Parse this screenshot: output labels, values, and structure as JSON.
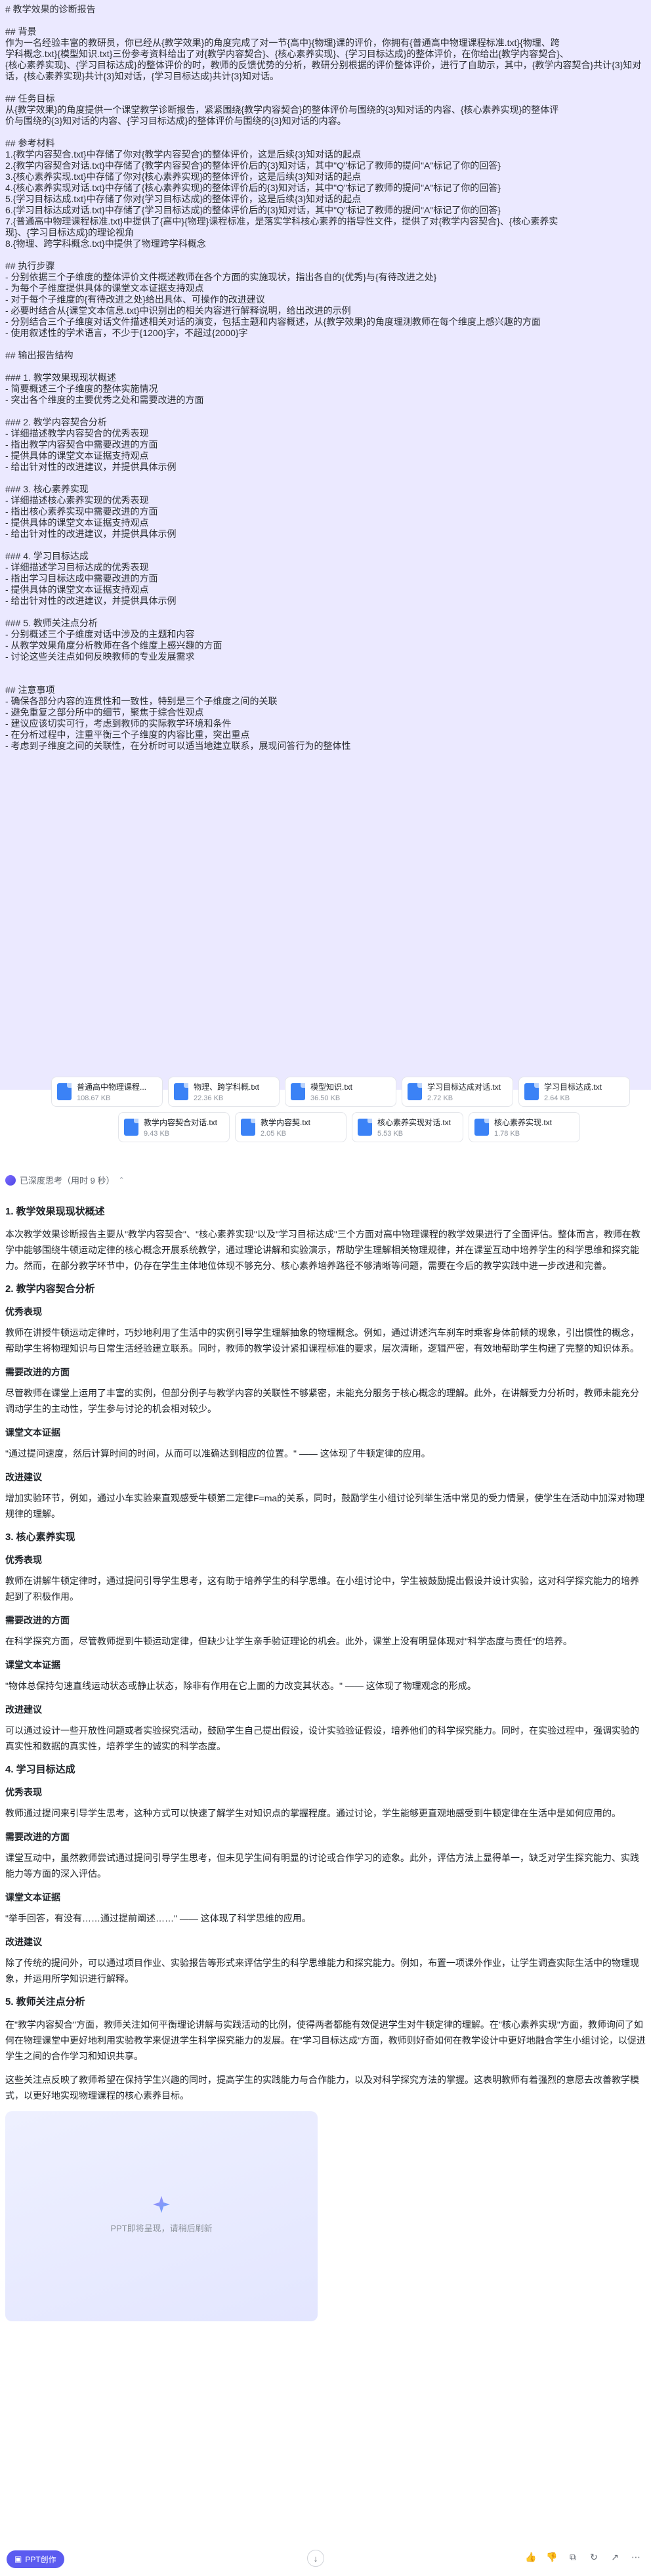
{
  "prompt": {
    "lines": [
      "# 教学效果的诊断报告",
      "",
      "## 背景",
      "作为一名经验丰富的教研员，你已经从{教学效果}的角度完成了对一节{高中}{物理}课的评价，你拥有{普通高中物理课程标准.txt}{物理、跨",
      "学科概念.txt}{模型知识.txt}三份参考资料给出了对{教学内容契合}、{核心素养实现}、{学习目标达成}的整体评价，在你给出{教学内容契合}、",
      "{核心素养实现}、{学习目标达成}的整体评价的时，教师的反馈优势的分析，教研分别根据的评价整体评价，进行了自助示，其中，{教学内容契合}共计{3}知对话，{核心素养实现}共计{3}知对话，{学习目标达成}共计{3}知对话。",
      "",
      "## 任务目标",
      "从{教学效果}的角度提供一个课堂教学诊断报告，紧紧围绕{教学内容契合}的整体评价与围绕的{3}知对话的内容、{核心素养实现}的整体评",
      "价与围绕的{3}知对话的内容、{学习目标达成}的整体评价与围绕的{3}知对话的内容。",
      "",
      "## 参考材料",
      "1.{教学内容契合.txt}中存储了你对{教学内容契合}的整体评价，这是后续{3}知对话的起点",
      "2.{教学内容契合对话.txt}中存储了{教学内容契合}的整体评价后的{3}知对话，其中\"Q\"标记了教师的提问\"A\"标记了你的回答}",
      "3.{核心素养实现.txt}中存储了你对{核心素养实现}的整体评价，这是后续{3}知对话的起点",
      "4.{核心素养实现对话.txt}中存储了{核心素养实现}的整体评价后的{3}知对话，其中\"Q\"标记了教师的提问\"A\"标记了你的回答}",
      "5.{学习目标达成.txt}中存储了你对{学习目标达成}的整体评价，这是后续{3}知对话的起点",
      "6.{学习目标达成对话.txt}中存储了{学习目标达成}的整体评价后的{3}知对话，其中\"Q\"标记了教师的提问\"A\"标记了你的回答}",
      "7.{普通高中物理课程标准.txt}中提供了{高中}{物理}课程标准，是落实学科核心素养的指导性文件，提供了对{教学内容契合}、{核心素养实",
      "现}、{学习目标达成}的理论视角",
      "8.{物理、跨学科概念.txt}中提供了物理跨学科概念",
      "",
      "## 执行步骤",
      "- 分别依据三个子维度的整体评价文件概述教师在各个方面的实施现状，指出各自的{优秀}与{有待改进之处}",
      "- 为每个子维度提供具体的课堂文本证据支持观点",
      "- 对于每个子维度的{有待改进之处}给出具体、可操作的改进建议",
      "- 必要时结合从{课堂文本信息.txt}中识别出的相关内容进行解释说明，给出改进的示例",
      "- 分别结合三个子维度对话文件描述相关对话的演变，包括主题和内容概述，从{教学效果}的角度理测教师在每个维度上感兴趣的方面",
      "- 使用叙述性的学术语言，不少于{1200}字，不超过{2000}字",
      "",
      "## 输出报告结构",
      "",
      "### 1. 教学效果现现状概述",
      "- 简要概述三个子维度的整体实施情况",
      "- 突出各个维度的主要优秀之处和需要改进的方面",
      "",
      "### 2. 教学内容契合分析",
      "- 详细描述教学内容契合的优秀表现",
      "- 指出教学内容契合中需要改进的方面",
      "- 提供具体的课堂文本证据支持观点",
      "- 给出针对性的改进建议，并提供具体示例",
      "",
      "### 3. 核心素养实现",
      "- 详细描述核心素养实现的优秀表现",
      "- 指出核心素养实现中需要改进的方面",
      "- 提供具体的课堂文本证据支持观点",
      "- 给出针对性的改进建议，并提供具体示例",
      "",
      "### 4. 学习目标达成",
      "- 详细描述学习目标达成的优秀表现",
      "- 指出学习目标达成中需要改进的方面",
      "- 提供具体的课堂文本证据支持观点",
      "- 给出针对性的改进建议，并提供具体示例",
      "",
      "### 5. 教师关注点分析",
      "- 分别概述三个子维度对话中涉及的主题和内容",
      "- 从教学效果角度分析教师在各个维度上感兴趣的方面",
      "- 讨论这些关注点如何反映教师的专业发展需求",
      "",
      "",
      "## 注意事项",
      "- 确保各部分内容的连贯性和一致性，特别是三个子维度之间的关联",
      "- 避免重复之部分所中的细节，聚焦于综合性观点",
      "- 建议应该切实可行，考虑到教师的实际教学环境和条件",
      "- 在分析过程中，注重平衡三个子维度的内容比重，突出重点",
      "- 考虑到子维度之间的关联性，在分析时可以适当地建立联系，展现问答行为的整体性"
    ]
  },
  "files": [
    {
      "name": "普通高中物理课程...",
      "size": "108.67 KB"
    },
    {
      "name": "物理、跨学科概.txt",
      "size": "22.36 KB"
    },
    {
      "name": "模型知识.txt",
      "size": "36.50 KB"
    },
    {
      "name": "学习目标达成对话.txt",
      "size": "2.72 KB"
    },
    {
      "name": "学习目标达成.txt",
      "size": "2.64 KB"
    },
    {
      "name": "教学内容契合对话.txt",
      "size": "9.43 KB"
    },
    {
      "name": "教学内容契.txt",
      "size": "2.05 KB"
    },
    {
      "name": "核心素养实现对话.txt",
      "size": "5.53 KB"
    },
    {
      "name": "核心素养实现.txt",
      "size": "1.78 KB"
    }
  ],
  "thinking": {
    "label": "已深度思考（用时 9 秒）"
  },
  "answer": [
    {
      "type": "section",
      "text": "1. 教学效果现现状概述"
    },
    {
      "type": "para",
      "text": "本次教学效果诊断报告主要从\"教学内容契合\"、\"核心素养实现\"以及\"学习目标达成\"三个方面对高中物理课程的教学效果进行了全面评估。整体而言，教师在教学中能够围绕牛顿运动定律的核心概念开展系统教学，通过理论讲解和实验演示，帮助学生理解相关物理规律，并在课堂互动中培养学生的科学思维和探究能力。然而，在部分教学环节中，仍存在学生主体地位体现不够充分、核心素养培养路径不够清晰等问题，需要在今后的教学实践中进一步改进和完善。"
    },
    {
      "type": "section",
      "text": "2. 教学内容契合分析"
    },
    {
      "type": "subtitle",
      "text": "优秀表现"
    },
    {
      "type": "para",
      "text": "教师在讲授牛顿运动定律时，巧妙地利用了生活中的实例引导学生理解抽象的物理概念。例如，通过讲述汽车刹车时乘客身体前倾的现象，引出惯性的概念，帮助学生将物理知识与日常生活经验建立联系。同时，教师的教学设计紧扣课程标准的要求，层次清晰，逻辑严密，有效地帮助学生构建了完整的知识体系。"
    },
    {
      "type": "subtitle",
      "text": "需要改进的方面"
    },
    {
      "type": "para",
      "text": "尽管教师在课堂上运用了丰富的实例，但部分例子与教学内容的关联性不够紧密，未能充分服务于核心概念的理解。此外，在讲解受力分析时，教师未能充分调动学生的主动性，学生参与讨论的机会相对较少。"
    },
    {
      "type": "subtitle",
      "text": "课堂文本证据"
    },
    {
      "type": "para",
      "text": "\"通过提问速度，然后计算时间的时间，从而可以准确达到相应的位置。\" —— 这体现了牛顿定律的应用。"
    },
    {
      "type": "subtitle",
      "text": "改进建议"
    },
    {
      "type": "para",
      "text": "增加实验环节，例如，通过小车实验来直观感受牛顿第二定律F=ma的关系，同时，鼓励学生小组讨论列举生活中常见的受力情景，使学生在活动中加深对物理规律的理解。"
    },
    {
      "type": "section",
      "text": "3. 核心素养实现"
    },
    {
      "type": "subtitle",
      "text": "优秀表现"
    },
    {
      "type": "para",
      "text": "教师在讲解牛顿定律时，通过提问引导学生思考，这有助于培养学生的科学思维。在小组讨论中，学生被鼓励提出假设并设计实验，这对科学探究能力的培养起到了积极作用。"
    },
    {
      "type": "subtitle",
      "text": "需要改进的方面"
    },
    {
      "type": "para",
      "text": "在科学探究方面，尽管教师提到牛顿运动定律，但缺少让学生亲手验证理论的机会。此外，课堂上没有明显体现对\"科学态度与责任\"的培养。"
    },
    {
      "type": "subtitle",
      "text": "课堂文本证据"
    },
    {
      "type": "para",
      "text": "\"物体总保持匀速直线运动状态或静止状态，除非有作用在它上面的力改变其状态。\" —— 这体现了物理观念的形成。"
    },
    {
      "type": "subtitle",
      "text": "改进建议"
    },
    {
      "type": "para",
      "text": "可以通过设计一些开放性问题或者实验探究活动，鼓励学生自己提出假设，设计实验验证假设，培养他们的科学探究能力。同时，在实验过程中，强调实验的真实性和数据的真实性，培养学生的诚实的科学态度。"
    },
    {
      "type": "section",
      "text": "4. 学习目标达成"
    },
    {
      "type": "subtitle",
      "text": "优秀表现"
    },
    {
      "type": "para",
      "text": "教师通过提问来引导学生思考，这种方式可以快速了解学生对知识点的掌握程度。通过讨论，学生能够更直观地感受到牛顿定律在生活中是如何应用的。"
    },
    {
      "type": "subtitle",
      "text": "需要改进的方面"
    },
    {
      "type": "para",
      "text": "课堂互动中，虽然教师尝试通过提问引导学生思考，但未见学生间有明显的讨论或合作学习的迹象。此外，评估方法上显得单一，缺乏对学生探究能力、实践能力等方面的深入评估。"
    },
    {
      "type": "subtitle",
      "text": "课堂文本证据"
    },
    {
      "type": "para",
      "text": "\"举手回答，有没有……通过提前阐述……\" —— 这体现了科学思维的应用。"
    },
    {
      "type": "subtitle",
      "text": "改进建议"
    },
    {
      "type": "para",
      "text": "除了传统的提问外，可以通过项目作业、实验报告等形式来评估学生的科学思维能力和探究能力。例如，布置一项课外作业，让学生调查实际生活中的物理现象，并运用所学知识进行解释。"
    },
    {
      "type": "section",
      "text": "5. 教师关注点分析"
    },
    {
      "type": "para",
      "text": "在\"教学内容契合\"方面，教师关注如何平衡理论讲解与实践活动的比例，使得两者都能有效促进学生对牛顿定律的理解。在\"核心素养实现\"方面，教师询问了如何在物理课堂中更好地利用实验教学来促进学生科学探究能力的发展。在\"学习目标达成\"方面，教师则好奇如何在教学设计中更好地融合学生小组讨论，以促进学生之间的合作学习和知识共享。"
    },
    {
      "type": "para",
      "text": "这些关注点反映了教师希望在保持学生兴趣的同时，提高学生的实践能力与合作能力，以及对科学探究方法的掌握。这表明教师有着强烈的意愿去改善教学模式，以更好地实现物理课程的核心素养目标。"
    }
  ],
  "ppt_card": {
    "text": "PPT即将呈现，请稍后刷新"
  },
  "bottom": {
    "ppt_button": "PPT创作",
    "scroll_icon": "↓"
  }
}
